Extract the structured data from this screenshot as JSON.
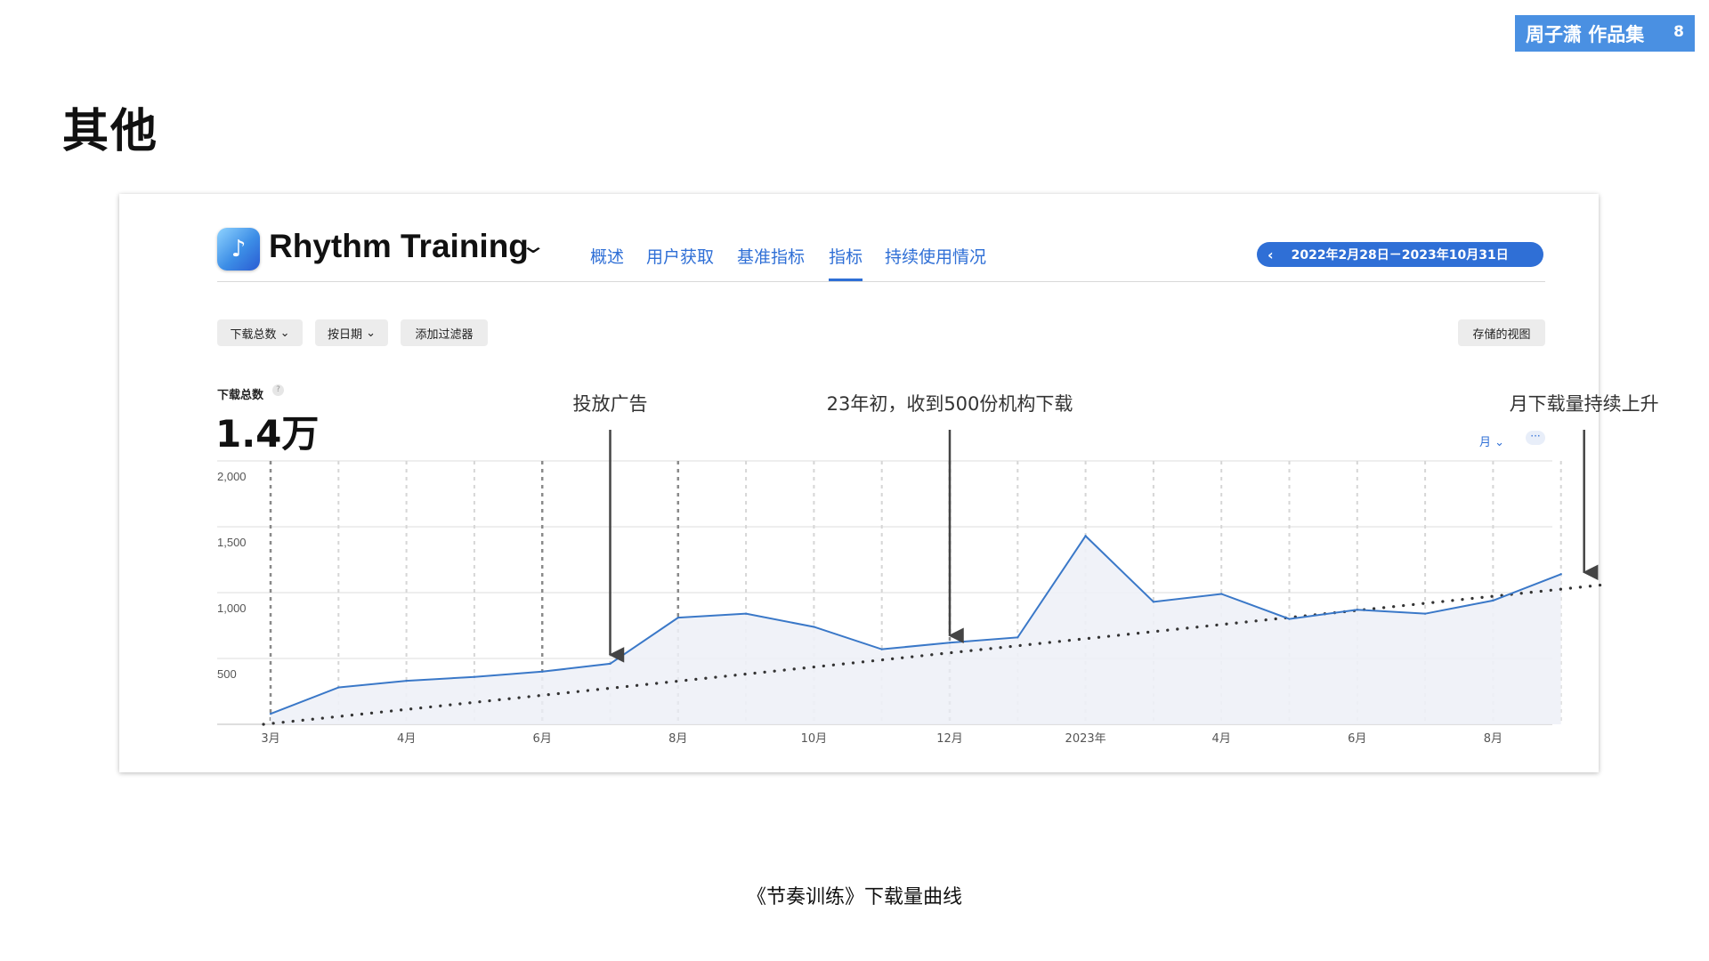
{
  "badge": {
    "author": "周子潇 作品集",
    "page": "8"
  },
  "page_title": "其他",
  "app": {
    "name": "Rhythm Training",
    "icon": "music-note-icon"
  },
  "tabs": [
    {
      "label": "概述",
      "active": false
    },
    {
      "label": "用户获取",
      "active": false
    },
    {
      "label": "基准指标",
      "active": false
    },
    {
      "label": "指标",
      "active": true
    },
    {
      "label": "持续使用情况",
      "active": false
    }
  ],
  "date_range": "2022年2月28日－2023年10月31日",
  "filters": {
    "metric": "下载总数",
    "group": "按日期",
    "add": "添加过滤器",
    "saved": "存储的视图"
  },
  "metric": {
    "label": "下载总数",
    "help": "?",
    "value": "1.4万"
  },
  "granularity": "月",
  "more": "···",
  "caption": "《节奏训练》下载量曲线",
  "colors": {
    "accent": "#2f6fd6",
    "badge": "#4a90e2",
    "line": "#3a78c8"
  },
  "chart_data": {
    "type": "line",
    "x_tick_labels": [
      "3月",
      "4月",
      "6月",
      "8月",
      "10月",
      "12月",
      "2023年",
      "4月",
      "6月",
      "8月"
    ],
    "x": [
      "2022-03",
      "2022-04",
      "2022-05",
      "2022-06",
      "2022-07",
      "2022-08",
      "2022-09",
      "2022-10",
      "2022-11",
      "2022-12",
      "2023-01",
      "2023-02",
      "2023-03",
      "2023-04",
      "2023-05",
      "2023-06",
      "2023-07",
      "2023-08",
      "2023-09",
      "2023-10"
    ],
    "series": [
      {
        "values": [
          80,
          280,
          330,
          360,
          400,
          460,
          810,
          840,
          740,
          570,
          620,
          660,
          1430,
          930,
          990,
          800,
          870,
          840,
          940,
          1140
        ]
      }
    ],
    "y_ticks": [
      "500",
      "1,000",
      "1,500",
      "2,000"
    ],
    "ylim": [
      0,
      2000
    ],
    "grid": true,
    "trendline": {
      "style": "dotted",
      "start": 0,
      "end": 1060
    },
    "annotations": [
      {
        "text": "投放广告",
        "x": "2022-08"
      },
      {
        "text": "23年初，收到500份机构下载",
        "x": "2023-01"
      },
      {
        "text": "月下载量持续上升",
        "x": "2023-10"
      }
    ]
  }
}
